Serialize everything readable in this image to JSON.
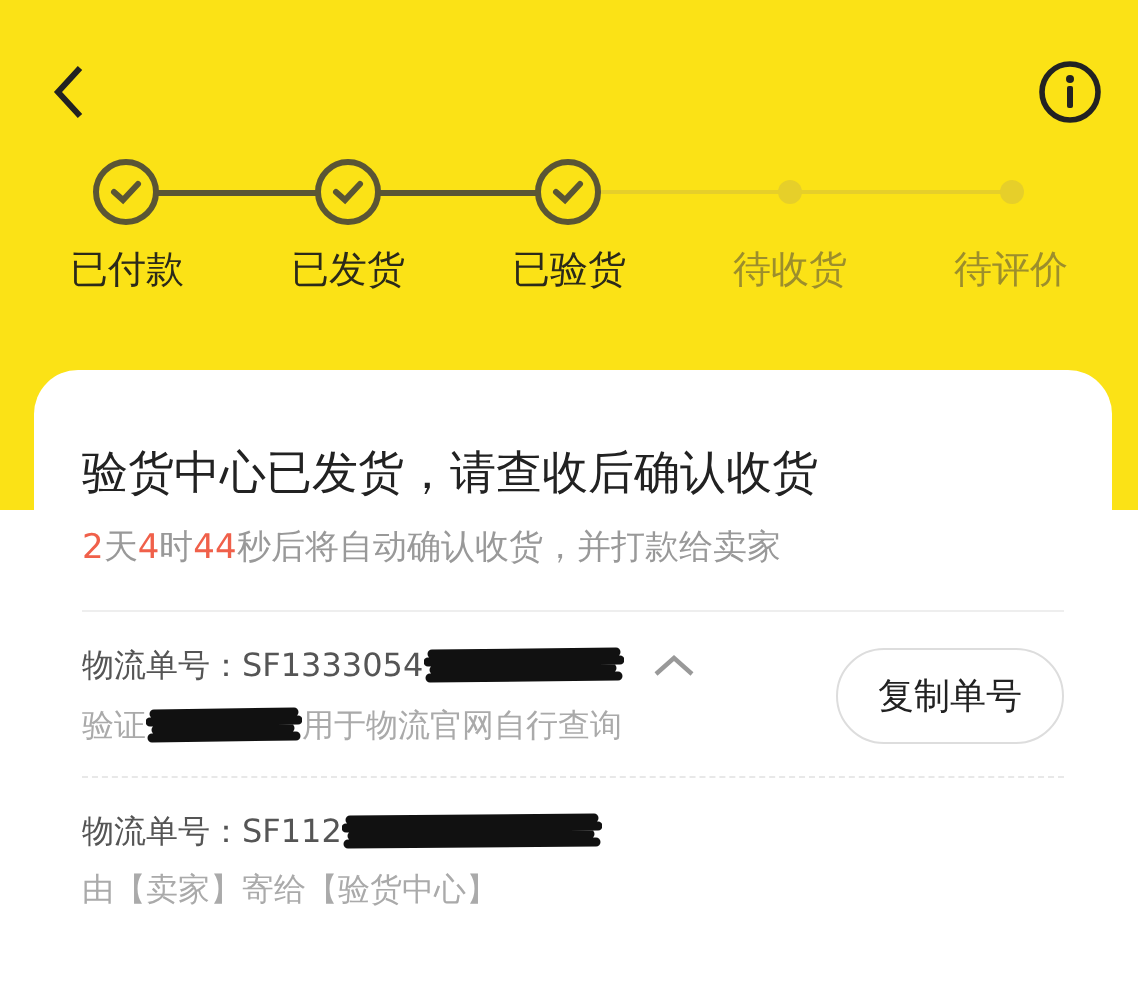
{
  "steps": [
    {
      "label": "已付款",
      "done": true
    },
    {
      "label": "已发货",
      "done": true
    },
    {
      "label": "已验货",
      "done": true
    },
    {
      "label": "待收货",
      "done": false
    },
    {
      "label": "待评价",
      "done": false
    }
  ],
  "status": {
    "title": "验货中心已发货，请查收后确认收货",
    "countdown": [
      {
        "text": "2",
        "highlight": true
      },
      {
        "text": "天",
        "highlight": false
      },
      {
        "text": "4",
        "highlight": true
      },
      {
        "text": "时",
        "highlight": false
      },
      {
        "text": "44",
        "highlight": true
      },
      {
        "text": "秒后将自动确认收货，并打款给卖家",
        "highlight": false
      }
    ]
  },
  "shipments": [
    {
      "number": "物流单号：SF1333054",
      "note_start": "验证",
      "note_end": "用于物流官网自行查询",
      "expanded": true,
      "copy_button": "复制单号"
    },
    {
      "number": "物流单号：SF112",
      "note_start": "由【卖家】寄给【验货中心】"
    }
  ]
}
